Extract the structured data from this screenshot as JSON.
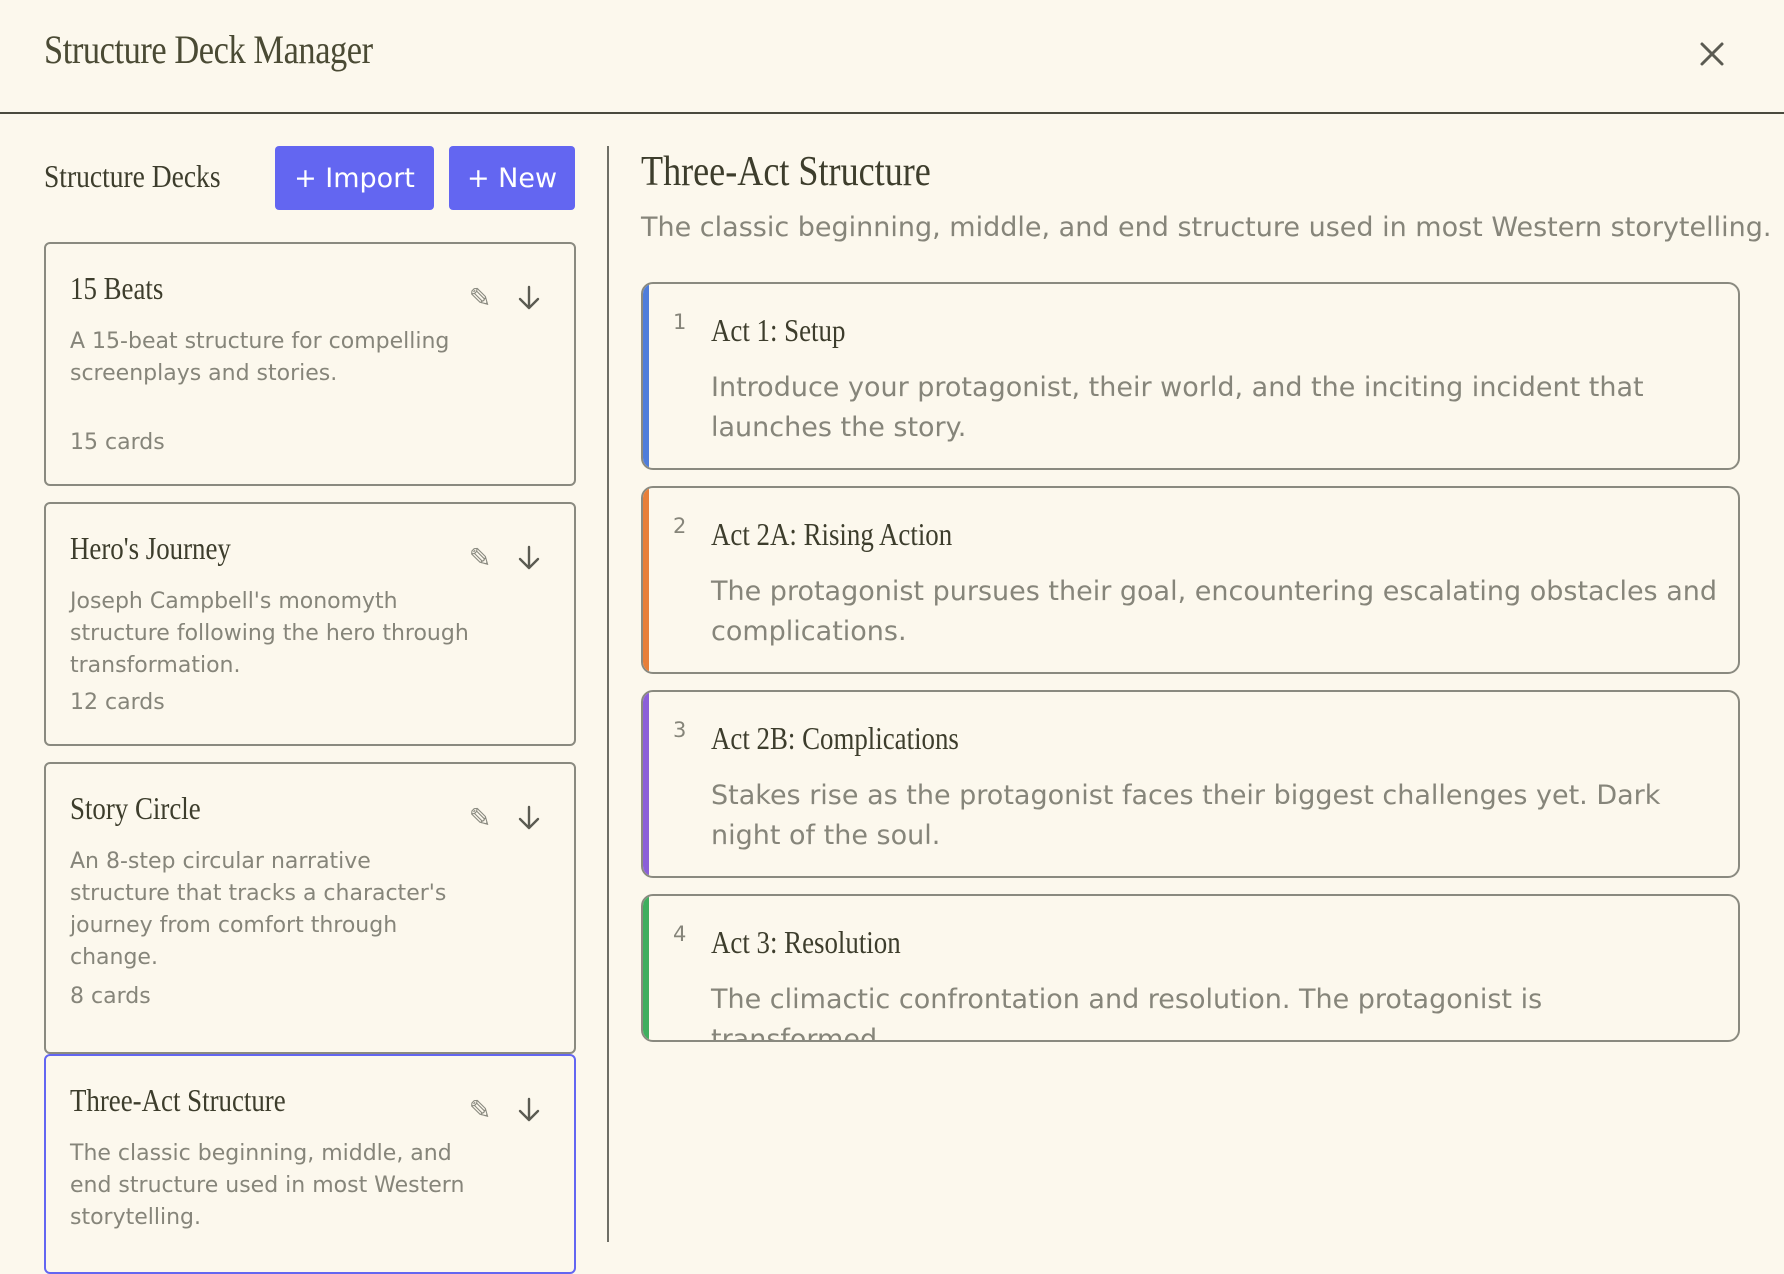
{
  "header": {
    "title": "Structure Deck Manager"
  },
  "sidebar": {
    "label": "Structure Decks",
    "import_label": "+ Import",
    "new_label": "+ New",
    "decks": [
      {
        "name": "15 Beats",
        "description": "A 15-beat structure for compelling screenplays and stories.",
        "count": "15 cards",
        "selected": false
      },
      {
        "name": "Hero's Journey",
        "description": "Joseph Campbell's monomyth structure following the hero through transformation.",
        "count": "12 cards",
        "selected": false
      },
      {
        "name": "Story Circle",
        "description": "An 8-step circular narrative structure that tracks a character's journey from comfort through change.",
        "count": "8 cards",
        "selected": false
      },
      {
        "name": "Three-Act Structure",
        "description": "The classic beginning, middle, and end structure used in most Western storytelling.",
        "count": "",
        "selected": true
      }
    ],
    "icons": {
      "edit": "pencil-icon",
      "export": "download-arrow-icon"
    }
  },
  "main": {
    "title": "Three-Act Structure",
    "description": "The classic beginning, middle, and end structure used in most Western storytelling.",
    "acts": [
      {
        "number": "1",
        "title": "Act 1: Setup",
        "description": "Introduce your protagonist, their world, and the inciting incident that launches the story.",
        "color": "#4f7ddb"
      },
      {
        "number": "2",
        "title": "Act 2A: Rising Action",
        "description": "The protagonist pursues their goal, encountering escalating obstacles and complications.",
        "color": "#e77f3a"
      },
      {
        "number": "3",
        "title": "Act 2B: Complications",
        "description": "Stakes rise as the protagonist faces their biggest challenges yet. Dark night of the soul.",
        "color": "#8b5fd9"
      },
      {
        "number": "4",
        "title": "Act 3: Resolution",
        "description": "The climactic confrontation and resolution. The protagonist is transformed.",
        "color": "#3fae5f"
      }
    ]
  },
  "colors": {
    "accent": "#6366f1",
    "background": "#fcf8ed",
    "text": "#3d3d2c",
    "muted": "#86857a"
  }
}
